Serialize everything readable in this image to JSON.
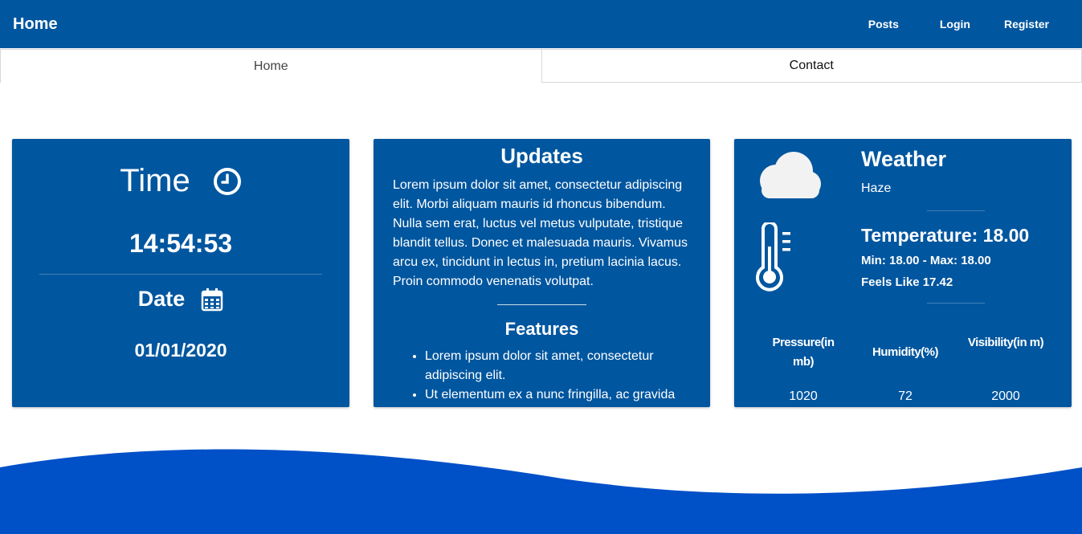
{
  "nav": {
    "brand": "Home",
    "links": [
      "Posts",
      "Login",
      "Register"
    ]
  },
  "tabs": [
    "Home",
    "Contact"
  ],
  "time_card": {
    "title": "Time",
    "time": "14:54:53",
    "date_title": "Date",
    "date": "01/01/2020",
    "icons": [
      "clock-icon",
      "calendar-icon"
    ]
  },
  "updates_card": {
    "title": "Updates",
    "text": "Lorem ipsum dolor sit amet, consectetur adipiscing elit. Morbi aliquam mauris id rhoncus bibendum. Nulla sem erat, luctus vel metus vulputate, tristique blandit tellus. Donec et malesuada mauris. Vivamus arcu ex, tincidunt in lectus in, pretium lacinia lacus. Proin commodo venenatis volutpat.",
    "features_title": "Features",
    "features": [
      "Lorem ipsum dolor sit amet, consectetur adipiscing elit.",
      "Ut elementum ex a nunc fringilla, ac gravida"
    ]
  },
  "weather_card": {
    "title": "Weather",
    "description": "Haze",
    "temperature": "Temperature: 18.00",
    "min_max": "Min: 18.00 - Max: 18.00",
    "feels_like": "Feels Like 17.42",
    "stats": [
      {
        "label": "Pressure(in mb)",
        "value": "1020"
      },
      {
        "label": "Humidity(%)",
        "value": "72"
      },
      {
        "label": "Visibility(in m)",
        "value": "2000"
      }
    ],
    "icons": [
      "cloud-icon",
      "thermometer-icon"
    ]
  },
  "colors": {
    "primary": "#00569f",
    "wave": "#0050c8",
    "text_on_primary": "#ffffff"
  }
}
